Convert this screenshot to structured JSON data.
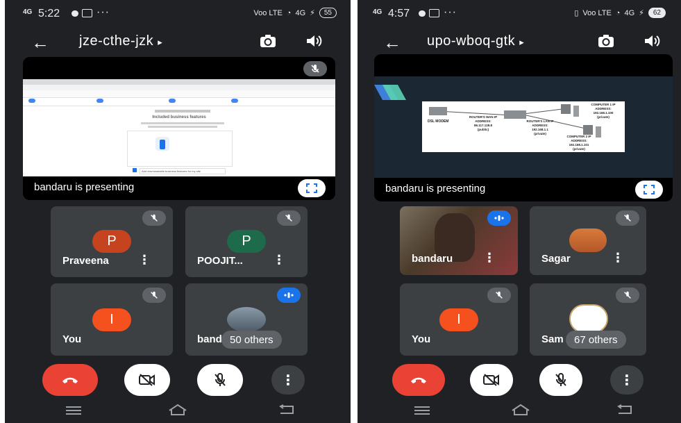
{
  "left": {
    "status": {
      "signal": "4G",
      "time": "5:22",
      "network": "Voo LTE",
      "net_type": "4G",
      "battery": "55"
    },
    "meeting_code": "jze-cthe-jzk",
    "presenting_text": "bandaru is presenting",
    "shared_screen": {
      "heading": "Included business features",
      "option": "Add downloadable business features for my site"
    },
    "tiles": [
      {
        "name": "Praveena",
        "initial": "P",
        "color": "#c5431f"
      },
      {
        "name": "POOJIT...",
        "initial": "P",
        "color": "#1e6b4c"
      },
      {
        "name": "You",
        "initial": "I",
        "color": "#f4511e"
      },
      {
        "name": "band",
        "others": "50 others"
      }
    ]
  },
  "right": {
    "status": {
      "signal": "4G",
      "time": "4:57",
      "network": "Voo LTE",
      "net_type": "4G",
      "battery": "62"
    },
    "meeting_code": "upo-wboq-gtk",
    "presenting_text": "bandaru is presenting",
    "diagram": {
      "modem": "DSL MODEM",
      "wan": "ROUTER'S WAN IP ADDRESS:",
      "wan_ip": "86.117.128.8",
      "wan_scope": "(public)",
      "lan": "ROUTER'S LAN IP ADDRESS:",
      "lan_ip": "192.168.1.1",
      "lan_scope": "(private)",
      "c1": "COMPUTER 1 IP ADDRESS:",
      "c1_ip": "192.168.1.100",
      "c1_scope": "(private)",
      "c2": "COMPUTER 2 IP ADDRESS:",
      "c2_ip": "192.168.1.101",
      "c2_scope": "(private)"
    },
    "tiles": [
      {
        "name": "bandaru"
      },
      {
        "name": "Sagar"
      },
      {
        "name": "You",
        "initial": "I",
        "color": "#f4511e"
      },
      {
        "name": "Sam",
        "others": "67 others"
      }
    ]
  },
  "colors": {
    "bg": "#202124",
    "tile": "#3c4043",
    "end_call": "#ea4335",
    "speaking": "#1a73e8"
  }
}
